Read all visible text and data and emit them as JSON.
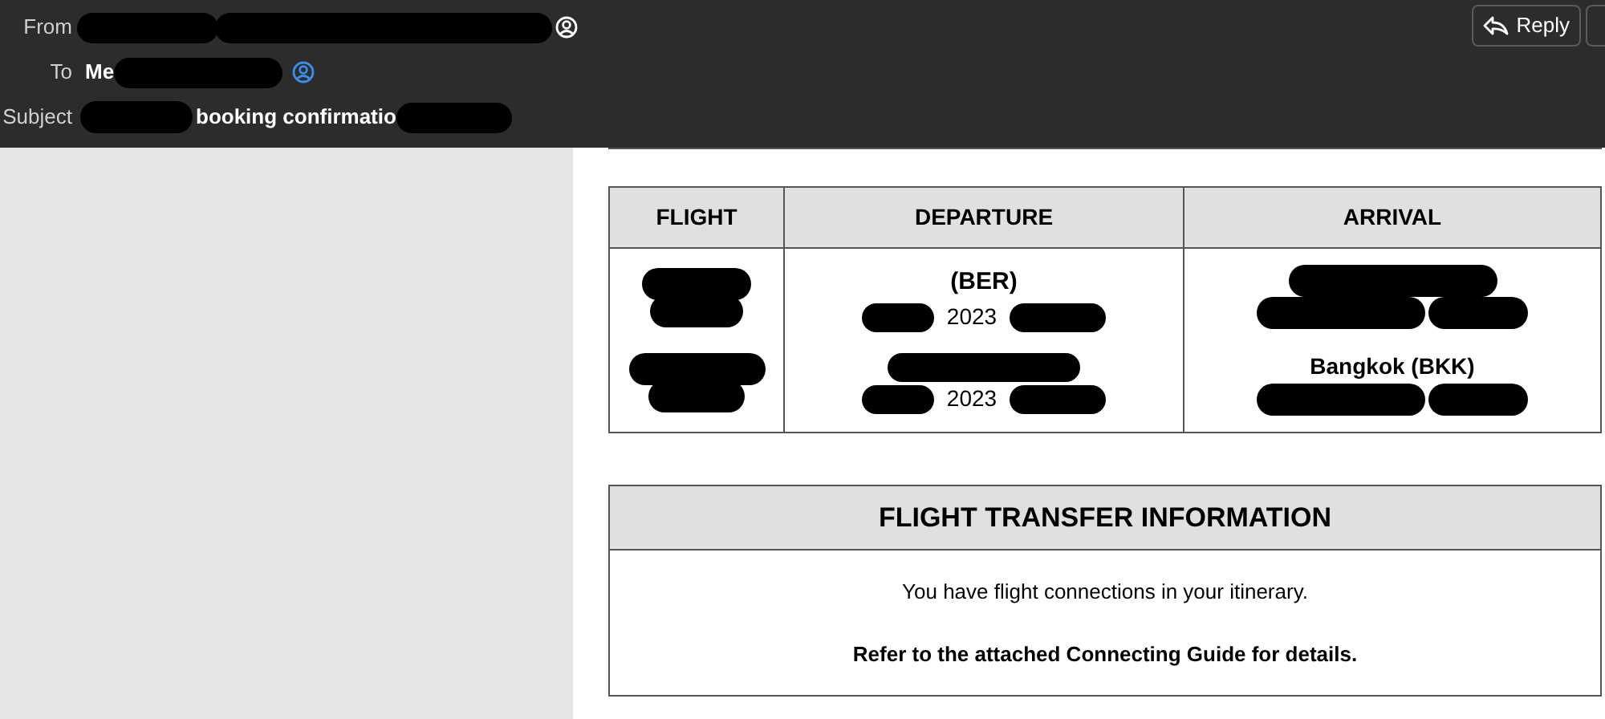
{
  "header": {
    "from_label": "From",
    "to_label": "To",
    "to_name": "Me",
    "subject_label": "Subject",
    "subject": "booking confirmatio",
    "reply_button": "Reply"
  },
  "flights_table": {
    "columns": [
      "FLIGHT",
      "DEPARTURE",
      "ARRIVAL"
    ],
    "rows": [
      {
        "departure": [
          "(BER)",
          "2023"
        ],
        "arrival": []
      },
      {
        "departure": [
          "2023"
        ],
        "arrival": [
          "Bangkok (BKK)"
        ]
      }
    ]
  },
  "transfer_box": {
    "title": "FLIGHT TRANSFER INFORMATION",
    "lines": [
      {
        "text": "You have flight connections in your itinerary.",
        "bold": false
      },
      {
        "text": "Refer to the attached Connecting Guide for details.",
        "bold": true
      }
    ]
  }
}
